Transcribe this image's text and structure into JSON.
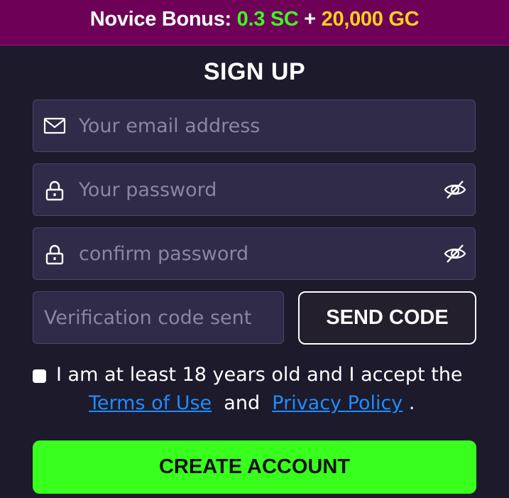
{
  "banner": {
    "prefix": "Novice Bonus: ",
    "sc_amount": "0.3 SC",
    "plus": " + ",
    "gc_amount": "20,000 GC"
  },
  "form": {
    "title": "SIGN UP",
    "email": {
      "placeholder": "Your email address",
      "icon": "mail-icon"
    },
    "password": {
      "placeholder": "Your password",
      "icon": "lock-icon",
      "toggle_icon": "eye-slash-icon"
    },
    "confirm_password": {
      "placeholder": "confirm password",
      "icon": "lock-icon",
      "toggle_icon": "eye-slash-icon"
    },
    "verification": {
      "placeholder": "Verification code sent"
    },
    "send_code_label": "SEND CODE",
    "agreement": {
      "checked": false,
      "line1": "I am at least 18 years old and I accept the",
      "terms_label": "Terms of Use",
      "and": "  and  ",
      "privacy_label": "Privacy Policy",
      "period": " ."
    },
    "create_account_label": "CREATE ACCOUNT"
  },
  "colors": {
    "background": "#1c1a2b",
    "banner": "#6e0058",
    "sc_green": "#39ff1e",
    "gc_yellow": "#ffd21a",
    "field_bg": "#302b48",
    "link_blue": "#1f8cff",
    "cta_green": "#39ff1e"
  }
}
